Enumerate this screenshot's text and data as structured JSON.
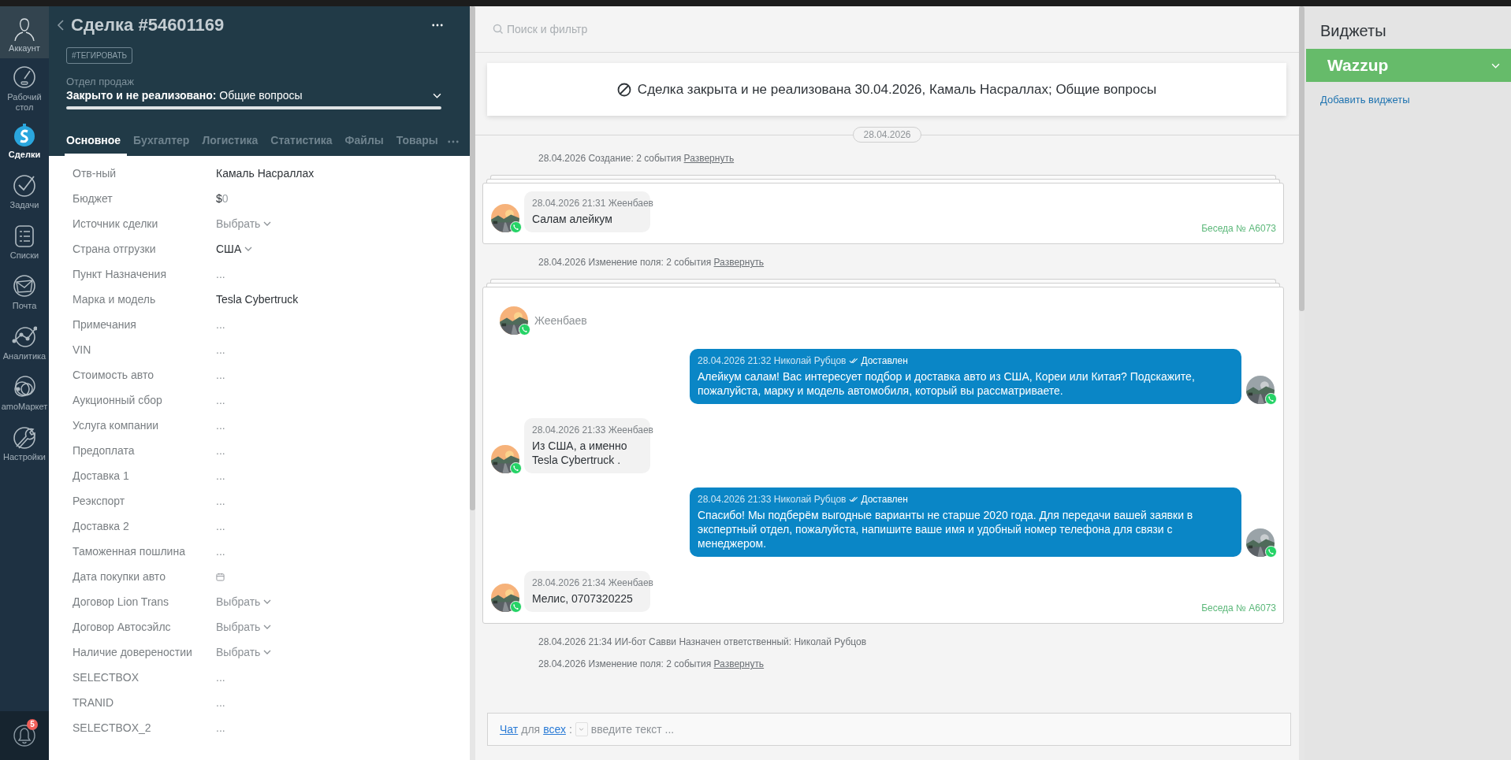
{
  "nav": {
    "account": {
      "label": "Аккаунт"
    },
    "items": [
      {
        "label": "Рабочий стол",
        "selected": false
      },
      {
        "label": "Сделки",
        "selected": true
      },
      {
        "label": "Задачи",
        "selected": false
      },
      {
        "label": "Списки",
        "selected": false
      },
      {
        "label": "Почта",
        "selected": false
      },
      {
        "label": "Аналитика",
        "selected": false
      },
      {
        "label": "amoМаркет",
        "selected": false
      },
      {
        "label": "Настройки",
        "selected": false
      }
    ],
    "notifications": {
      "count": "5"
    }
  },
  "deal": {
    "title": "Сделка #54601169",
    "tag_button": "#ТЕГИРОВАТЬ",
    "pipeline": "Отдел продаж",
    "status": "**Закрыто и не реализовано:** Общие вопросы",
    "tabs": [
      {
        "label": "Основное",
        "selected": true
      },
      {
        "label": "Бухгалтер",
        "selected": false
      },
      {
        "label": "Логистика",
        "selected": false
      },
      {
        "label": "Статистика",
        "selected": false
      },
      {
        "label": "Файлы",
        "selected": false
      },
      {
        "label": "Товары",
        "selected": false
      }
    ]
  },
  "fields": [
    {
      "label": "Отв-ный",
      "kind": "text",
      "value": "Камаль Насраллах"
    },
    {
      "label": "Бюджет",
      "kind": "money",
      "currency": "$",
      "value": "0"
    },
    {
      "label": "Источник сделки",
      "kind": "select",
      "placeholder": "Выбрать"
    },
    {
      "label": "Страна отгрузки",
      "kind": "select",
      "value": "США"
    },
    {
      "label": "Пункт Назначения",
      "kind": "empty",
      "value": "..."
    },
    {
      "label": "Марка и модель",
      "kind": "text",
      "value": "Tesla Cybertruck"
    },
    {
      "label": "Примечания",
      "kind": "empty",
      "value": "..."
    },
    {
      "label": "VIN",
      "kind": "empty",
      "value": "..."
    },
    {
      "label": "Стоимость авто",
      "kind": "empty",
      "value": "..."
    },
    {
      "label": "Аукционный сбор",
      "kind": "empty",
      "value": "..."
    },
    {
      "label": "Услуга компании",
      "kind": "empty",
      "value": "..."
    },
    {
      "label": "Предоплата",
      "kind": "empty",
      "value": "..."
    },
    {
      "label": "Доставка 1",
      "kind": "empty",
      "value": "..."
    },
    {
      "label": "Реэкспорт",
      "kind": "empty",
      "value": "..."
    },
    {
      "label": "Доставка 2",
      "kind": "empty",
      "value": "..."
    },
    {
      "label": "Таможенная пошлина",
      "kind": "empty",
      "value": "..."
    },
    {
      "label": "Дата покупки авто",
      "kind": "date"
    },
    {
      "label": "Договор Lion Trans",
      "kind": "select",
      "placeholder": "Выбрать"
    },
    {
      "label": "Договор Автосэйлс",
      "kind": "select",
      "placeholder": "Выбрать"
    },
    {
      "label": "Наличие довереностии",
      "kind": "select",
      "placeholder": "Выбрать"
    },
    {
      "label": "SELECTBOX",
      "kind": "empty",
      "value": "..."
    },
    {
      "label": "TRANID",
      "kind": "empty",
      "value": "..."
    },
    {
      "label": "SELECTBOX_2",
      "kind": "empty",
      "value": "..."
    }
  ],
  "feed": {
    "search": {
      "placeholder": "Поиск и фильтр"
    },
    "banner": "Сделка закрыта и не реализована 30.04.2026, Камаль Насраллах; Общие вопросы",
    "date": "28.04.2026",
    "items": [
      {
        "kind": "note",
        "text": "28.04.2026 Создание: 2 события",
        "link": "Развернуть"
      },
      {
        "kind": "chat",
        "conversation": "Беседа № A6073",
        "messages": [
          {
            "kind": "incoming",
            "meta": "28.04.2026 21:31 Жеенбаев",
            "text": "Салам алейкум"
          }
        ]
      },
      {
        "kind": "note",
        "text": "28.04.2026 Изменение поля: 2 события",
        "link": "Развернуть"
      },
      {
        "kind": "chat",
        "author": "Жеенбаев",
        "conversation": "Беседа № A6073",
        "messages": [
          {
            "kind": "outgoing",
            "meta": "28.04.2026 21:32 Николай Рубцов",
            "status": "Доставлен",
            "text": "Алейкум салам! Вас интересует подбор и доставка авто из США, Кореи или Китая? Подскажите, пожалуйста, марку и модель автомобиля, который вы рассматриваете."
          },
          {
            "kind": "incoming",
            "meta": "28.04.2026 21:33 Жеенбаев",
            "text": "Из США, а именно Tesla Cybertruck ."
          },
          {
            "kind": "outgoing",
            "meta": "28.04.2026 21:33 Николай Рубцов",
            "status": "Доставлен",
            "text": "Спасибо! Мы подберём выгодные варианты не старше 2020 года. Для передачи вашей заявки в экспертный отдел, пожалуйста, напишите ваше имя и удобный номер телефона для связи с менеджером."
          },
          {
            "kind": "incoming",
            "meta": "28.04.2026 21:34 Жеенбаев",
            "text": "Мелис, 0707320225"
          }
        ]
      },
      {
        "kind": "note",
        "text": "28.04.2026 21:34 ИИ-бот Савви Назначен ответственный: Николай Рубцов"
      },
      {
        "kind": "note",
        "text": "28.04.2026 Изменение поля: 2 события",
        "link": "Развернуть"
      }
    ],
    "composer": {
      "channel": "Чат",
      "joiner": "для",
      "audience": "всех",
      "colon": ":",
      "placeholder": "введите текст ..."
    }
  },
  "widgets": {
    "title": "Виджеты",
    "items": [
      {
        "label": "Wazzup"
      }
    ],
    "add_link": "Добавить виджеты"
  }
}
